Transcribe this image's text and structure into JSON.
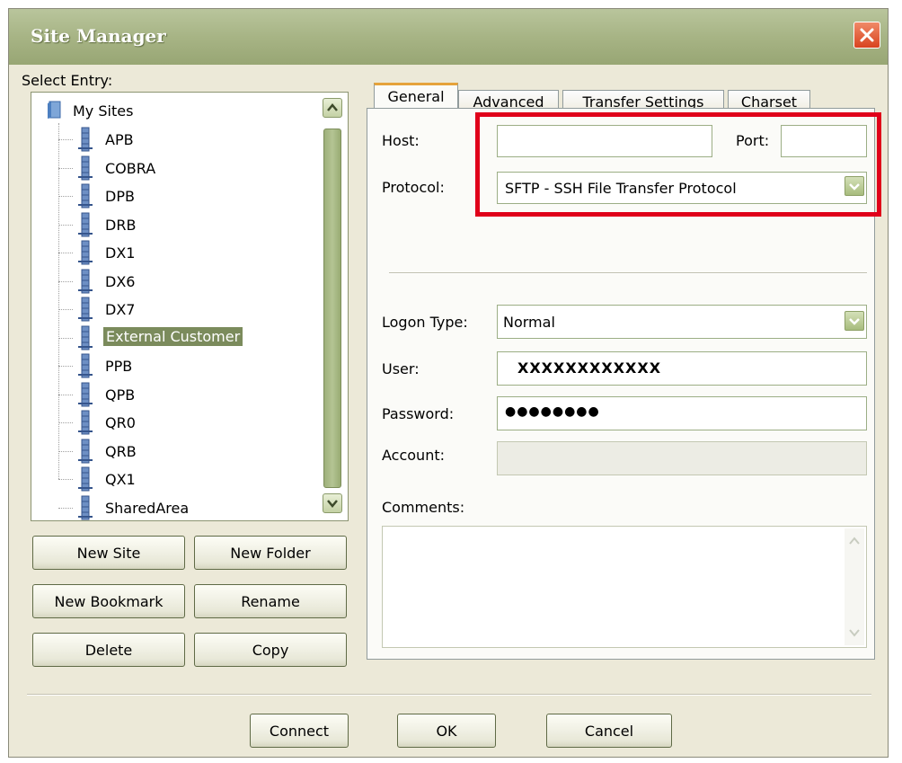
{
  "window": {
    "title": "Site Manager"
  },
  "left": {
    "select_label": "Select Entry:",
    "root": "My Sites",
    "sites": [
      "APB",
      "COBRA",
      "DPB",
      "DRB",
      "DX1",
      "DX6",
      "DX7",
      "External Customer",
      "PPB",
      "QPB",
      "QR0",
      "QRB",
      "QX1",
      "SharedArea"
    ],
    "selected": "External Customer",
    "buttons": {
      "new_site": "New Site",
      "new_folder": "New Folder",
      "new_bookmark": "New Bookmark",
      "rename": "Rename",
      "delete": "Delete",
      "copy": "Copy"
    }
  },
  "tabs": [
    "General",
    "Advanced",
    "Transfer Settings",
    "Charset"
  ],
  "general": {
    "host_label": "Host:",
    "host_value": "",
    "port_label": "Port:",
    "port_value": "",
    "protocol_label": "Protocol:",
    "protocol_value": "SFTP - SSH File Transfer Protocol",
    "logon_label": "Logon Type:",
    "logon_value": "Normal",
    "user_label": "User:",
    "user_value": "XXXXXXXXXXXX",
    "password_label": "Password:",
    "password_value": "●●●●●●●●",
    "account_label": "Account:",
    "account_value": "",
    "comments_label": "Comments:",
    "comments_value": ""
  },
  "footer": {
    "connect": "Connect",
    "ok": "OK",
    "cancel": "Cancel"
  },
  "colors": {
    "highlight": "#e0001a",
    "selection": "#7b8b5c",
    "titlebar": "#a7b485"
  },
  "icons": [
    "close-icon",
    "folder-icon",
    "site-icon",
    "scroll-up-icon",
    "scroll-down-icon",
    "chevron-down-icon"
  ]
}
